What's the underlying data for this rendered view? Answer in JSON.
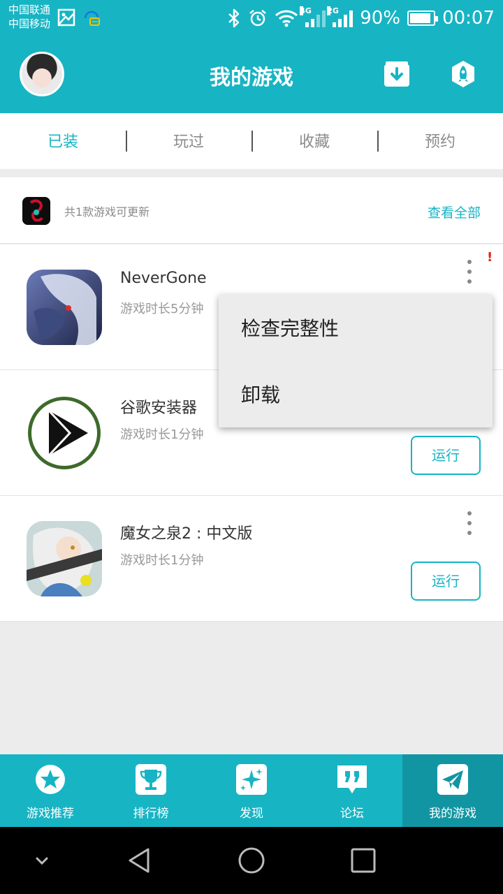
{
  "status_bar": {
    "carrier_1": "中国联通",
    "carrier_2": "中国移动",
    "net_1": "4G",
    "net_2": "2G",
    "battery": "90%",
    "time": "00:07"
  },
  "header": {
    "title": "我的游戏",
    "accent_color": "#17b4c4"
  },
  "tabs": [
    {
      "label": "已装",
      "active": true
    },
    {
      "label": "玩过",
      "active": false
    },
    {
      "label": "收藏",
      "active": false
    },
    {
      "label": "预约",
      "active": false
    }
  ],
  "update_banner": {
    "text": "共1款游戏可更新",
    "link": "查看全部"
  },
  "games": [
    {
      "name": "NeverGone",
      "playtime": "游戏时长5分钟",
      "alert": "!"
    },
    {
      "name": "谷歌安装器",
      "playtime": "游戏时长1分钟",
      "action": "运行"
    },
    {
      "name": "魔女之泉2 : 中文版",
      "playtime": "游戏时长1分钟",
      "action": "运行"
    }
  ],
  "popup_menu": {
    "items": [
      "检查完整性",
      "卸载"
    ]
  },
  "bottom_nav": [
    {
      "label": "游戏推荐",
      "icon": "star-icon"
    },
    {
      "label": "排行榜",
      "icon": "trophy-icon"
    },
    {
      "label": "发现",
      "icon": "sparkle-icon"
    },
    {
      "label": "论坛",
      "icon": "quote-icon"
    },
    {
      "label": "我的游戏",
      "icon": "paper-plane-icon",
      "active": true
    }
  ]
}
